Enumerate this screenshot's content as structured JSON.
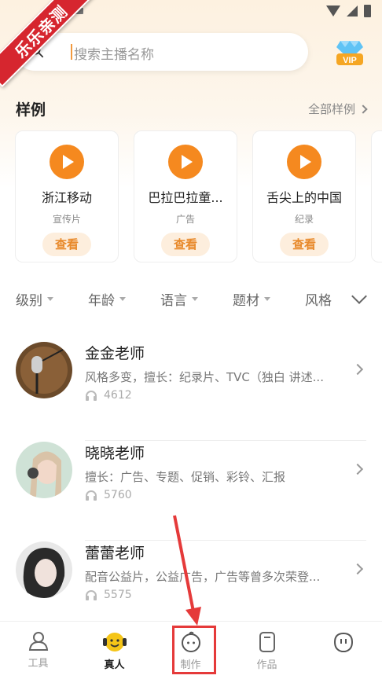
{
  "ribbon": {
    "text": "乐乐亲测"
  },
  "search": {
    "placeholder": "搜索主播名称"
  },
  "samples": {
    "title": "样例",
    "more": "全部样例",
    "cards": [
      {
        "title": "浙江移动",
        "category": "宣传片",
        "button": "查看"
      },
      {
        "title": "巴拉巴拉童...",
        "category": "广告",
        "button": "查看"
      },
      {
        "title": "舌尖上的中国",
        "category": "纪录",
        "button": "查看"
      }
    ]
  },
  "filters": [
    "级别",
    "年龄",
    "语言",
    "题材",
    "风格"
  ],
  "teachers": [
    {
      "name": "金金老师",
      "desc": "风格多变，擅长：纪录片、TVC（独白 讲述...",
      "plays": "4612"
    },
    {
      "name": "晓晓老师",
      "desc": "擅长：广告、专题、促销、彩铃、汇报",
      "plays": "5760"
    },
    {
      "name": "蕾蕾老师",
      "desc": "配音公益片，公益广告，广告等曾多次荣登...",
      "plays": "5575"
    }
  ],
  "tabs": [
    {
      "label": "工具",
      "icon": "tool-icon"
    },
    {
      "label": "真人",
      "icon": "face-icon",
      "active": true
    },
    {
      "label": "制作",
      "icon": "make-icon"
    },
    {
      "label": "作品",
      "icon": "works-icon"
    },
    {
      "label": "",
      "icon": "mine-icon"
    }
  ],
  "colors": {
    "accent": "#f5891f",
    "annotation": "#e53a3a"
  }
}
